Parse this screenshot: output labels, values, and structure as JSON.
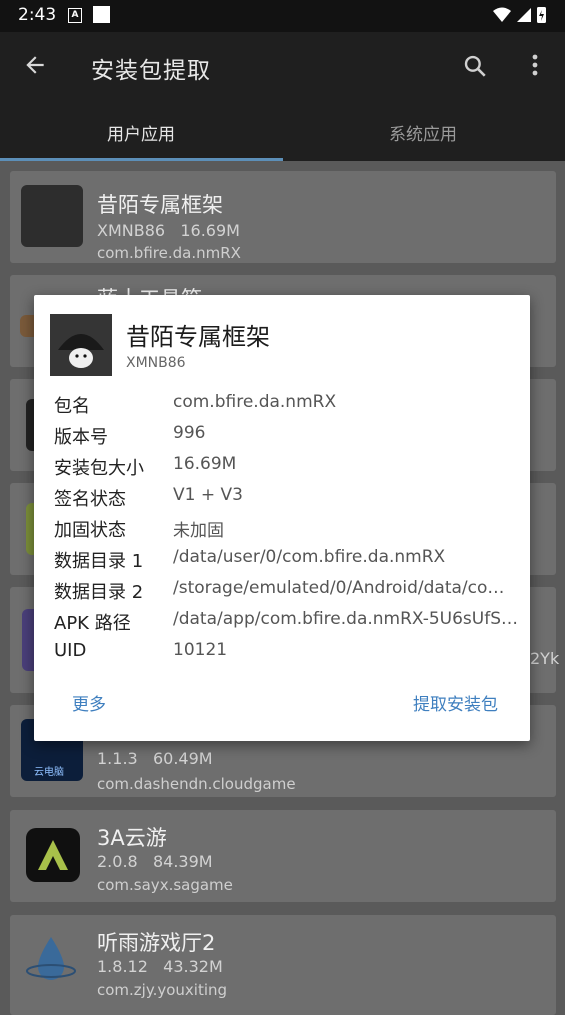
{
  "status": {
    "time": "2:43"
  },
  "appbar": {
    "title": "安装包提取"
  },
  "tabs": [
    {
      "label": "用户应用"
    },
    {
      "label": "系统应用"
    }
  ],
  "list": [
    {
      "name": "昔陌专属框架",
      "version": "XMNB86",
      "size": "16.69M",
      "pkg": "com.bfire.da.nmRX"
    },
    {
      "name": "",
      "version": "1.1.3",
      "size": "60.49M",
      "pkg": "com.dashendn.cloudgame"
    },
    {
      "name": "3A云游",
      "version": "2.0.8",
      "size": "84.39M",
      "pkg": "com.sayx.sagame"
    },
    {
      "name": "听雨游戏厅2",
      "version": "1.8.12",
      "size": "43.32M",
      "pkg": "com.zjy.youxiting"
    }
  ],
  "partial_text": {
    "card2_name": "蓝十工具箱",
    "card5_suffix": "2Yk",
    "dashen_icon_label": "云电脑"
  },
  "dialog": {
    "name": "昔陌专属框架",
    "version": "XMNB86",
    "rows": [
      {
        "k": "包名",
        "v": "com.bfire.da.nmRX"
      },
      {
        "k": "版本号",
        "v": "996"
      },
      {
        "k": "安装包大小",
        "v": "16.69M"
      },
      {
        "k": "签名状态",
        "v": "V1 + V3"
      },
      {
        "k": "加固状态",
        "v": "未加固"
      },
      {
        "k": "数据目录 1",
        "v": "/data/user/0/com.bfire.da.nmRX"
      },
      {
        "k": "数据目录 2",
        "v": "/storage/emulated/0/Android/data/co…"
      },
      {
        "k": "APK 路径",
        "v": "/data/app/com.bfire.da.nmRX-5U6sUfS…"
      },
      {
        "k": "UID",
        "v": "10121"
      }
    ],
    "more_label": "更多",
    "extract_label": "提取安装包"
  },
  "colors": {
    "accent": "#3f7fbf",
    "tab_indicator": "#5c8fb8"
  }
}
